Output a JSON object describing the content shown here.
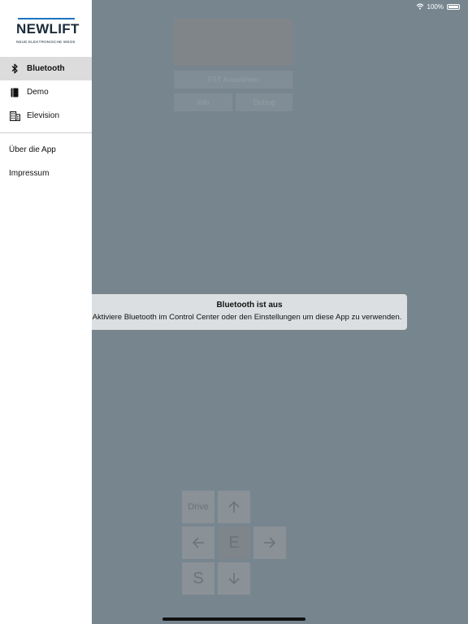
{
  "status_bar": {
    "battery_text": "100%",
    "battery_level_percent": 100
  },
  "logo": {
    "brand": "NEWLIFT",
    "tagline": "NEUE ELEKTRONISCHE WEGE"
  },
  "sidebar": {
    "items": [
      {
        "label": "Bluetooth",
        "icon": "bluetooth-icon",
        "active": true
      },
      {
        "label": "Demo",
        "icon": "book-icon",
        "active": false
      },
      {
        "label": "Elevision",
        "icon": "building-icon",
        "active": false
      }
    ],
    "secondary": [
      {
        "label": "Über die App"
      },
      {
        "label": "Impressum"
      }
    ]
  },
  "main": {
    "select_button": "FST Auswählen",
    "info_button": "Info",
    "debug_button": "Debug",
    "pad": {
      "drive": "Drive",
      "e": "E",
      "s": "S"
    }
  },
  "alert": {
    "title": "Bluetooth ist aus",
    "message": "Aktiviere Bluetooth im Control Center oder den Einstellungen um diese App zu verwenden."
  },
  "colors": {
    "overlay": "#77858f",
    "brand_blue": "#1f73c3",
    "active_bg": "#dcdcdc"
  }
}
